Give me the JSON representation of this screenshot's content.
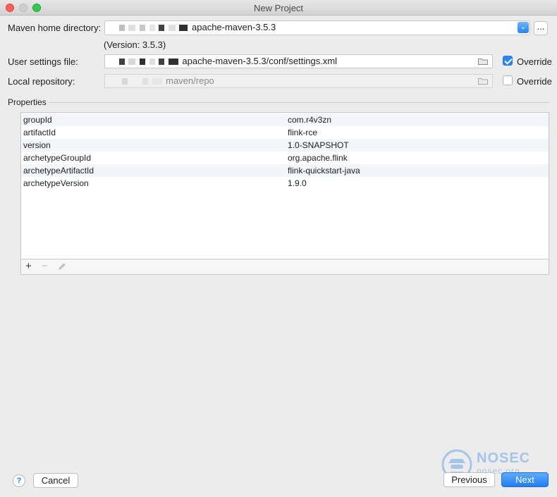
{
  "window": {
    "title": "New Project"
  },
  "maven_home": {
    "label": "Maven home directory:",
    "value": "apache-maven-3.5.3",
    "browse_label": "..."
  },
  "version_text": "(Version: 3.5.3)",
  "user_settings": {
    "label": "User settings file:",
    "value": "apache-maven-3.5.3/conf/settings.xml",
    "override_label": "Override",
    "override_checked": true
  },
  "local_repo": {
    "label": "Local repository:",
    "value": "maven/repo",
    "override_label": "Override",
    "override_checked": false
  },
  "properties": {
    "label": "Properties",
    "rows": [
      {
        "key": "groupId",
        "value": "com.r4v3zn"
      },
      {
        "key": "artifactId",
        "value": "flink-rce"
      },
      {
        "key": "version",
        "value": "1.0-SNAPSHOT"
      },
      {
        "key": "archetypeGroupId",
        "value": "org.apache.flink"
      },
      {
        "key": "archetypeArtifactId",
        "value": "flink-quickstart-java"
      },
      {
        "key": "archetypeVersion",
        "value": "1.9.0"
      }
    ],
    "toolbar": {
      "add": "+",
      "remove": "−"
    }
  },
  "footer": {
    "help": "?",
    "cancel": "Cancel",
    "previous": "Previous",
    "next": "Next"
  },
  "watermark": {
    "line1": "NOSEC",
    "line2": "nosec.org"
  },
  "colors": {
    "accent": "#2e85f4",
    "alt_row": "#f2f5f9"
  }
}
